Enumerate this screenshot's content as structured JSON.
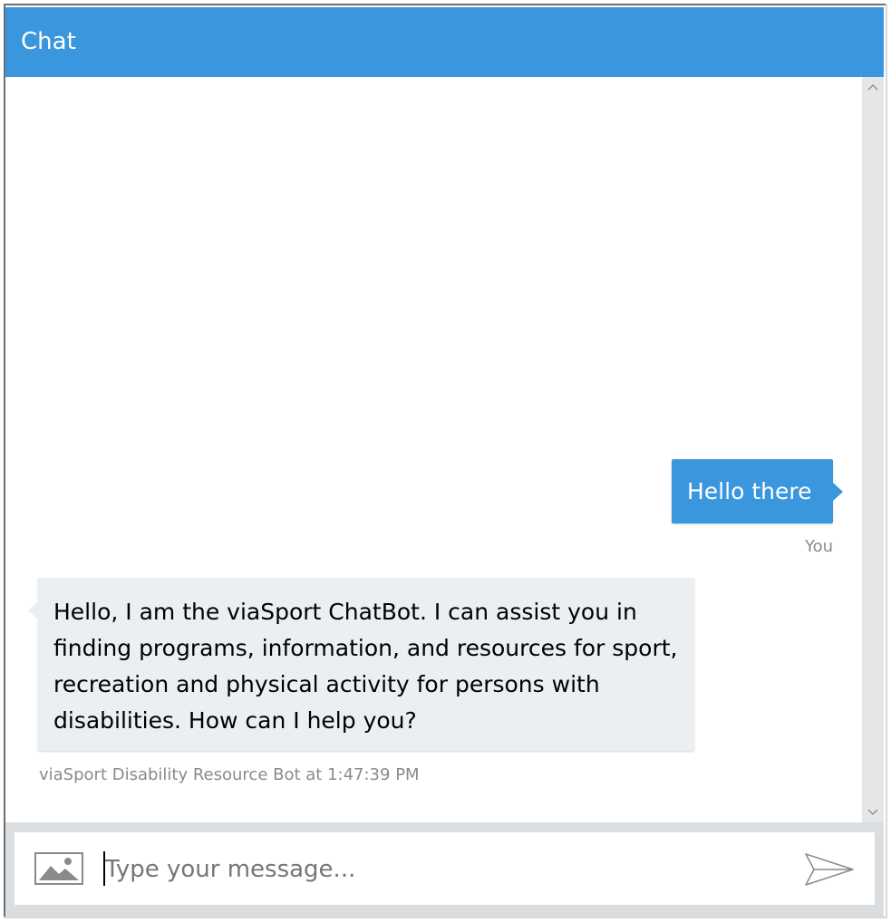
{
  "header": {
    "title": "Chat"
  },
  "messages": [
    {
      "from": "user",
      "text": "Hello there",
      "meta": "You"
    },
    {
      "from": "bot",
      "text": "Hello, I am the viaSport ChatBot. I can assist you in finding programs, information, and resources for sport, recreation and physical activity for persons with disabilities. How can I help you?",
      "meta": "viaSport Disability Resource Bot at 1:47:39 PM"
    }
  ],
  "composer": {
    "placeholder": "Type your message...",
    "value": ""
  },
  "icons": {
    "upload": "image-upload-icon",
    "send": "send-icon",
    "scroll_up": "chevron-up-icon",
    "scroll_down": "chevron-down-icon"
  },
  "colors": {
    "accent": "#3a96dd",
    "bot_bubble": "#eceff1",
    "shell": "#dbdee1",
    "meta_text": "#8a8a8a"
  }
}
